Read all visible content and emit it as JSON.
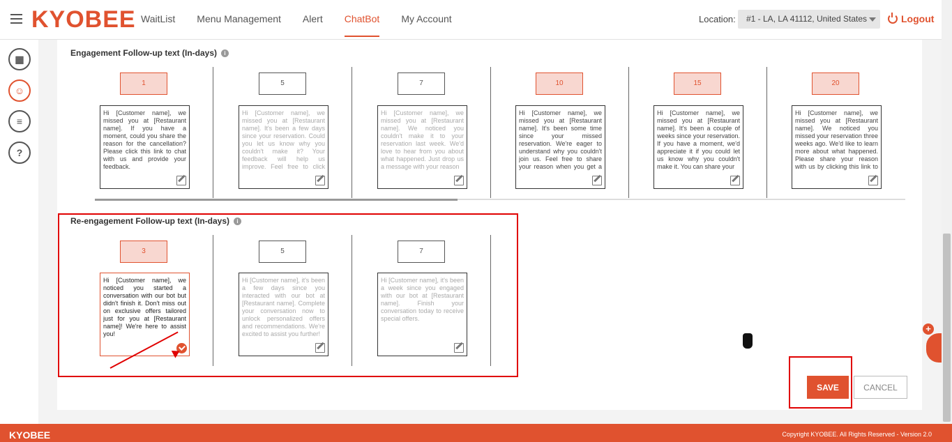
{
  "header": {
    "logo": "KYOBEE",
    "nav": [
      "WaitList",
      "Menu Management",
      "Alert",
      "ChatBot",
      "My Account"
    ],
    "active_nav": "ChatBot",
    "location_label": "Location:",
    "location_value": "#1 - LA, LA 41112, United States",
    "logout": "Logout"
  },
  "engagement": {
    "title": "Engagement Follow-up text (In-days)",
    "info": "i",
    "items": [
      {
        "day": "1",
        "text": "Hi [Customer name], we missed you at [Restaurant name]. If you have a moment, could you share the reason for the cancellation? Please click this link to chat with us and provide your feedback."
      },
      {
        "day": "5",
        "text": "Hi [Customer name], we missed you at [Restaurant name]. It's been a few days since your reservation. Could you let us know why you couldn't make it? Your feedback will help us improve. Feel free to click this"
      },
      {
        "day": "7",
        "text": "Hi [Customer name], we missed you at [Restaurant name]. We noticed you couldn't make it to your reservation last week. We'd love to hear from you about what happened. Just drop us a message with your reason"
      },
      {
        "day": "10",
        "text": "Hi [Customer name], we missed you at [Restaurant name]. It's been some time since your missed reservation. We're eager to understand why you couldn't join us. Feel free to share your reason when you get a chance"
      },
      {
        "day": "15",
        "text": "Hi [Customer name], we missed you at [Restaurant name]. It's been a couple of weeks since your reservation. If you have a moment, we'd appreciate it if you could let us know why you couldn't make it. You can share your"
      },
      {
        "day": "20",
        "text": "Hi [Customer name], we missed you at [Restaurant name]. We noticed you missed your reservation three weeks ago. We'd like to learn more about what happened. Please share your reason with us by clicking this link to chat"
      }
    ]
  },
  "reengagement": {
    "title": "Re-engagement Follow-up text (In-days)",
    "info": "i",
    "items": [
      {
        "day": "3",
        "text": "Hi [Customer name], we noticed you started a conversation with our bot but didn't finish it. Don't miss out on exclusive offers tailored just for you at [Restaurant name]! We're here to assist you!"
      },
      {
        "day": "5",
        "text": "Hi [Customer name], it's been a few days since you interacted with our bot at [Restaurant name]. Complete your conversation now to unlock personalized offers and recommendations. We're excited to assist you further!"
      },
      {
        "day": "7",
        "text": "Hi [Customer name], it's been a week since you engaged with our bot at [Restaurant name]. Finish your conversation today to receive special offers."
      }
    ]
  },
  "actions": {
    "save": "SAVE",
    "cancel": "CANCEL"
  },
  "footer": {
    "logo": "KYOBEE",
    "copyright": "Copyright KYOBEE. All Rights Reserved - Version 2.0"
  },
  "colors": {
    "brand": "#e0522f",
    "annotation": "#e00000"
  }
}
